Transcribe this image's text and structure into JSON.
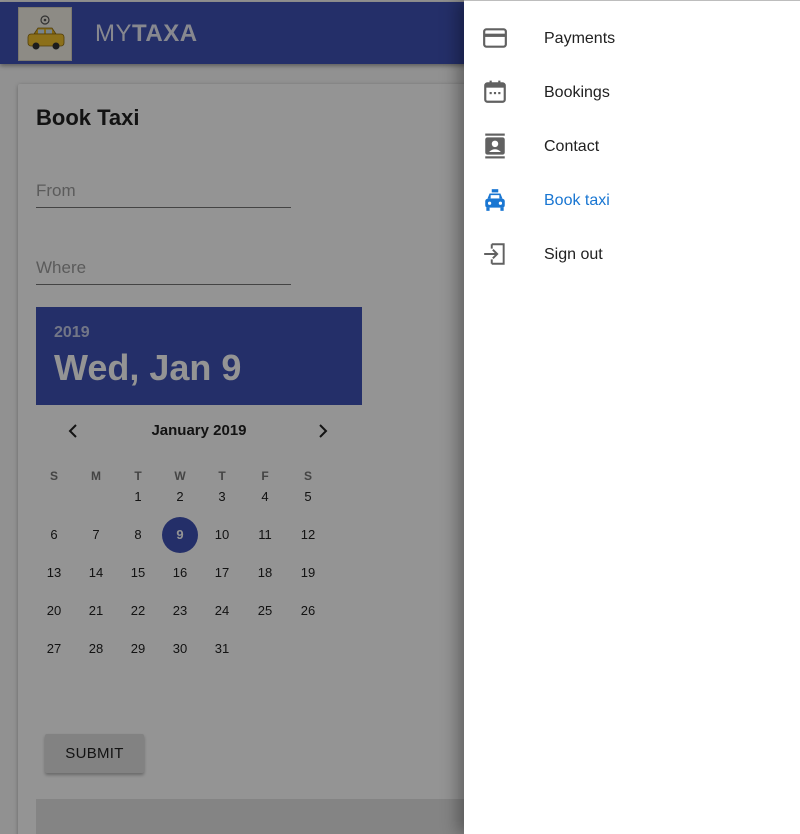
{
  "app": {
    "brand_prefix": "MY",
    "brand_suffix": "TAXA"
  },
  "form": {
    "title": "Book Taxi",
    "from_placeholder": "From",
    "where_placeholder": "Where",
    "submit_label": "SUBMIT"
  },
  "datepicker": {
    "year": "2019",
    "selected_label": "Wed, Jan 9",
    "month_label": "January 2019",
    "weekdays": [
      "S",
      "M",
      "T",
      "W",
      "T",
      "F",
      "S"
    ],
    "first_weekday_index": 2,
    "days_in_month": 31,
    "selected_day": 9,
    "accent_color": "#3f51b5"
  },
  "drawer": {
    "items": [
      {
        "label": "Payments",
        "icon": "credit-card-icon",
        "active": false
      },
      {
        "label": "Bookings",
        "icon": "calendar-icon",
        "active": false
      },
      {
        "label": "Contact",
        "icon": "contact-icon",
        "active": false
      },
      {
        "label": "Book taxi",
        "icon": "taxi-icon",
        "active": true
      },
      {
        "label": "Sign out",
        "icon": "sign-out-icon",
        "active": false
      }
    ],
    "active_color": "#1976d2"
  }
}
